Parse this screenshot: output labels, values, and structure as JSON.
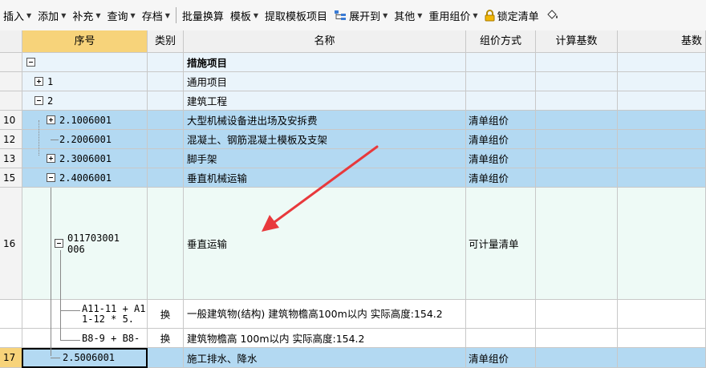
{
  "toolbar": {
    "items": [
      {
        "label": "插入",
        "dd": true
      },
      {
        "label": "添加",
        "dd": true
      },
      {
        "label": "补充",
        "dd": true
      },
      {
        "label": "查询",
        "dd": true
      },
      {
        "label": "存档",
        "dd": true
      },
      {
        "label": "批量换算",
        "dd": false
      },
      {
        "label": "模板",
        "dd": true
      },
      {
        "label": "提取模板项目",
        "dd": false
      },
      {
        "label": "展开到",
        "dd": true
      },
      {
        "label": "其他",
        "dd": true
      },
      {
        "label": "重用组价",
        "dd": true
      },
      {
        "label": "锁定清单",
        "dd": false
      }
    ]
  },
  "headers": {
    "rownum": "",
    "seq": "序号",
    "type": "类别",
    "name": "名称",
    "mode": "组价方式",
    "base": "计算基数",
    "base2": "基数"
  },
  "rows": [
    {
      "rownum": "",
      "seq": "",
      "type": "",
      "name": "措施项目",
      "mode": ""
    },
    {
      "rownum": "",
      "seq": "1",
      "type": "",
      "name": "通用项目",
      "mode": ""
    },
    {
      "rownum": "",
      "seq": "2",
      "type": "",
      "name": "建筑工程",
      "mode": ""
    },
    {
      "rownum": "10",
      "seq": "2.1006001",
      "type": "",
      "name": "大型机械设备进出场及安拆费",
      "mode": "清单组价"
    },
    {
      "rownum": "12",
      "seq": "2.2006001",
      "type": "",
      "name": "混凝土、钢筋混凝土模板及支架",
      "mode": "清单组价"
    },
    {
      "rownum": "13",
      "seq": "2.3006001",
      "type": "",
      "name": "脚手架",
      "mode": "清单组价"
    },
    {
      "rownum": "15",
      "seq": "2.4006001",
      "type": "",
      "name": "垂直机械运输",
      "mode": "清单组价"
    },
    {
      "rownum": "16",
      "seq": "011703001006",
      "type": "",
      "name": "垂直运输",
      "mode": "可计量清单"
    },
    {
      "rownum": "",
      "seq": "A11-11 + A11-12 * 5.",
      "type": "换",
      "name": "一般建筑物(结构) 建筑物檐高100m以内    实际高度:154.2",
      "mode": ""
    },
    {
      "rownum": "",
      "seq": "B8-9 + B8-",
      "type": "换",
      "name": "建筑物檐高 100m以内    实际高度:154.2",
      "mode": ""
    },
    {
      "rownum": "17",
      "seq": "2.5006001",
      "type": "",
      "name": "施工排水、降水",
      "mode": "清单组价"
    }
  ],
  "colors": {
    "selected_header": "#f7d37a",
    "row_blue": "#b3d9f2",
    "arrow": "#e8393c"
  }
}
